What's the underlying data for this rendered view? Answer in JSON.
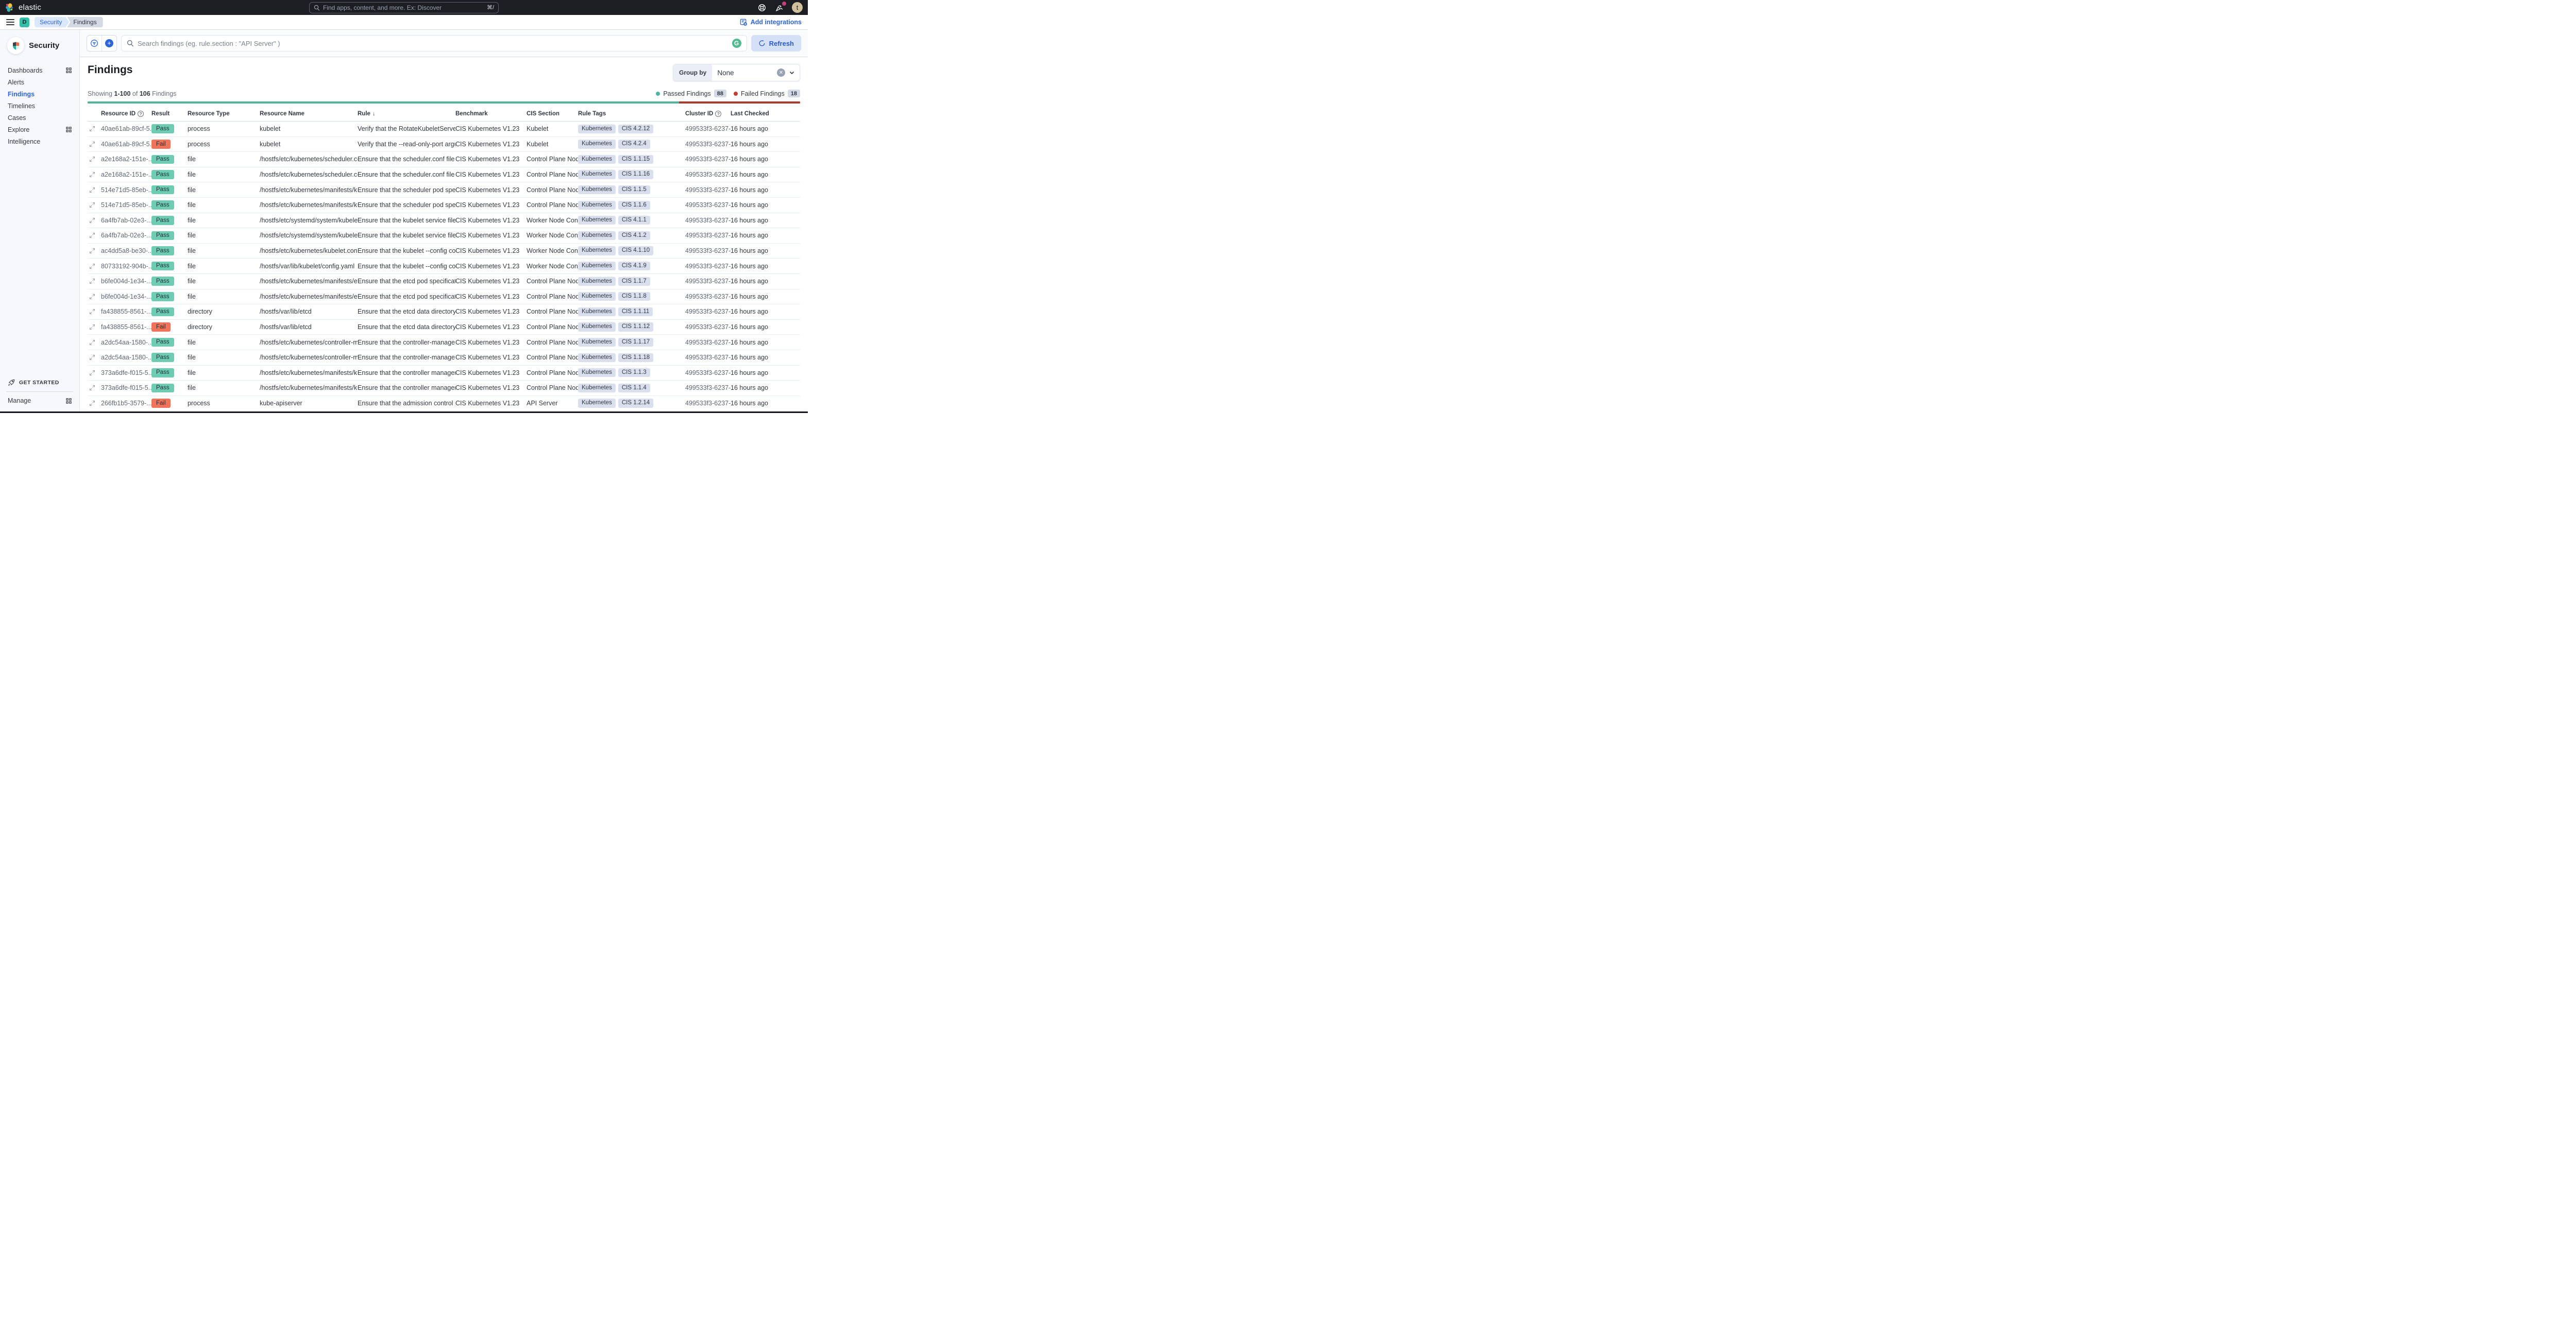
{
  "header": {
    "logo_text": "elastic",
    "search_placeholder": "Find apps, content, and more. Ex: Discover",
    "search_shortcut": "⌘/",
    "avatar_initial": "t"
  },
  "breadcrumb_bar": {
    "deployment_initial": "D",
    "crumbs": {
      "first": "Security",
      "last": "Findings"
    },
    "add_integrations_label": "Add integrations"
  },
  "sidebar": {
    "title": "Security",
    "items": [
      {
        "label": "Dashboards",
        "grid_icon": true
      },
      {
        "label": "Alerts",
        "grid_icon": false
      },
      {
        "label": "Findings",
        "grid_icon": false,
        "active": true
      },
      {
        "label": "Timelines",
        "grid_icon": false
      },
      {
        "label": "Cases",
        "grid_icon": false
      },
      {
        "label": "Explore",
        "grid_icon": true
      },
      {
        "label": "Intelligence",
        "grid_icon": false
      }
    ],
    "get_started_label": "GET STARTED",
    "manage_label": "Manage"
  },
  "toolbar": {
    "search_placeholder": "Search findings (eg. rule.section : \"API Server\" )",
    "refresh_label": "Refresh"
  },
  "page": {
    "title": "Findings",
    "group_by_label": "Group by",
    "group_by_value": "None"
  },
  "summary": {
    "showing_word": "Showing",
    "range": "1-100",
    "of_word": "of",
    "total": "106",
    "suffix_word": "Findings",
    "passed_label": "Passed Findings",
    "passed_count": "88",
    "failed_label": "Failed Findings",
    "failed_count": "18"
  },
  "colors": {
    "pass_badge": "#6dccb1",
    "fail_badge": "#f0735c",
    "passed_bar": "#54b399",
    "failed_bar": "#aa392e",
    "accent_blue": "#2d64d8",
    "deployment_teal": "#36bdaa"
  },
  "table": {
    "columns": [
      {
        "label": "Resource ID",
        "help": true
      },
      {
        "label": "Result"
      },
      {
        "label": "Resource Type"
      },
      {
        "label": "Resource Name"
      },
      {
        "label": "Rule",
        "sorted": "desc"
      },
      {
        "label": "Benchmark"
      },
      {
        "label": "CIS Section"
      },
      {
        "label": "Rule Tags"
      },
      {
        "label": "Cluster ID",
        "help": true
      },
      {
        "label": "Last Checked"
      }
    ],
    "rows": [
      {
        "resource_id": "40ae61ab-89cf-5...",
        "result": "Pass",
        "resource_type": "process",
        "resource_name": "kubelet",
        "rule": "Verify that the RotateKubeletServerCertifi...",
        "benchmark": "CIS Kubernetes V1.23",
        "cis_section": "Kubelet",
        "rule_tags": [
          "Kubernetes",
          "CIS 4.2.12"
        ],
        "cluster_id": "499533f3-6237-...",
        "last_checked": "16 hours ago"
      },
      {
        "resource_id": "40ae61ab-89cf-5...",
        "result": "Fail",
        "resource_type": "process",
        "resource_name": "kubelet",
        "rule": "Verify that the --read-only-port argument ...",
        "benchmark": "CIS Kubernetes V1.23",
        "cis_section": "Kubelet",
        "rule_tags": [
          "Kubernetes",
          "CIS 4.2.4"
        ],
        "cluster_id": "499533f3-6237-...",
        "last_checked": "16 hours ago"
      },
      {
        "resource_id": "a2e168a2-151e-...",
        "result": "Pass",
        "resource_type": "file",
        "resource_name": "/hostfs/etc/kubernetes/scheduler.conf",
        "rule": "Ensure that the scheduler.conf file permis...",
        "benchmark": "CIS Kubernetes V1.23",
        "cis_section": "Control Plane Node...",
        "rule_tags": [
          "Kubernetes",
          "CIS 1.1.15"
        ],
        "cluster_id": "499533f3-6237-...",
        "last_checked": "16 hours ago"
      },
      {
        "resource_id": "a2e168a2-151e-...",
        "result": "Pass",
        "resource_type": "file",
        "resource_name": "/hostfs/etc/kubernetes/scheduler.conf",
        "rule": "Ensure that the scheduler.conf file owners...",
        "benchmark": "CIS Kubernetes V1.23",
        "cis_section": "Control Plane Node...",
        "rule_tags": [
          "Kubernetes",
          "CIS 1.1.16"
        ],
        "cluster_id": "499533f3-6237-...",
        "last_checked": "16 hours ago"
      },
      {
        "resource_id": "514e71d5-85eb-...",
        "result": "Pass",
        "resource_type": "file",
        "resource_name": "/hostfs/etc/kubernetes/manifests/kube-sc...",
        "rule": "Ensure that the scheduler pod specificatio...",
        "benchmark": "CIS Kubernetes V1.23",
        "cis_section": "Control Plane Node...",
        "rule_tags": [
          "Kubernetes",
          "CIS 1.1.5"
        ],
        "cluster_id": "499533f3-6237-...",
        "last_checked": "16 hours ago"
      },
      {
        "resource_id": "514e71d5-85eb-...",
        "result": "Pass",
        "resource_type": "file",
        "resource_name": "/hostfs/etc/kubernetes/manifests/kube-sc...",
        "rule": "Ensure that the scheduler pod specificatio...",
        "benchmark": "CIS Kubernetes V1.23",
        "cis_section": "Control Plane Node...",
        "rule_tags": [
          "Kubernetes",
          "CIS 1.1.6"
        ],
        "cluster_id": "499533f3-6237-...",
        "last_checked": "16 hours ago"
      },
      {
        "resource_id": "6a4fb7ab-02e3-...",
        "result": "Pass",
        "resource_type": "file",
        "resource_name": "/hostfs/etc/systemd/system/kubelet.servi...",
        "rule": "Ensure that the kubelet service file permis...",
        "benchmark": "CIS Kubernetes V1.23",
        "cis_section": "Worker Node Confi...",
        "rule_tags": [
          "Kubernetes",
          "CIS 4.1.1"
        ],
        "cluster_id": "499533f3-6237-...",
        "last_checked": "16 hours ago"
      },
      {
        "resource_id": "6a4fb7ab-02e3-...",
        "result": "Pass",
        "resource_type": "file",
        "resource_name": "/hostfs/etc/systemd/system/kubelet.servi...",
        "rule": "Ensure that the kubelet service file owner...",
        "benchmark": "CIS Kubernetes V1.23",
        "cis_section": "Worker Node Confi...",
        "rule_tags": [
          "Kubernetes",
          "CIS 4.1.2"
        ],
        "cluster_id": "499533f3-6237-...",
        "last_checked": "16 hours ago"
      },
      {
        "resource_id": "ac4dd5a8-be30-...",
        "result": "Pass",
        "resource_type": "file",
        "resource_name": "/hostfs/etc/kubernetes/kubelet.conf",
        "rule": "Ensure that the kubelet --config configura...",
        "benchmark": "CIS Kubernetes V1.23",
        "cis_section": "Worker Node Confi...",
        "rule_tags": [
          "Kubernetes",
          "CIS 4.1.10"
        ],
        "cluster_id": "499533f3-6237-...",
        "last_checked": "16 hours ago"
      },
      {
        "resource_id": "80733192-904b-...",
        "result": "Pass",
        "resource_type": "file",
        "resource_name": "/hostfs/var/lib/kubelet/config.yaml",
        "rule": "Ensure that the kubelet --config configura...",
        "benchmark": "CIS Kubernetes V1.23",
        "cis_section": "Worker Node Confi...",
        "rule_tags": [
          "Kubernetes",
          "CIS 4.1.9"
        ],
        "cluster_id": "499533f3-6237-...",
        "last_checked": "16 hours ago"
      },
      {
        "resource_id": "b6fe004d-1e34-...",
        "result": "Pass",
        "resource_type": "file",
        "resource_name": "/hostfs/etc/kubernetes/manifests/etcd.yaml",
        "rule": "Ensure that the etcd pod specification file ...",
        "benchmark": "CIS Kubernetes V1.23",
        "cis_section": "Control Plane Node...",
        "rule_tags": [
          "Kubernetes",
          "CIS 1.1.7"
        ],
        "cluster_id": "499533f3-6237-...",
        "last_checked": "16 hours ago"
      },
      {
        "resource_id": "b6fe004d-1e34-...",
        "result": "Pass",
        "resource_type": "file",
        "resource_name": "/hostfs/etc/kubernetes/manifests/etcd.yaml",
        "rule": "Ensure that the etcd pod specification file ...",
        "benchmark": "CIS Kubernetes V1.23",
        "cis_section": "Control Plane Node...",
        "rule_tags": [
          "Kubernetes",
          "CIS 1.1.8"
        ],
        "cluster_id": "499533f3-6237-...",
        "last_checked": "16 hours ago"
      },
      {
        "resource_id": "fa438855-8561-...",
        "result": "Pass",
        "resource_type": "directory",
        "resource_name": "/hostfs/var/lib/etcd",
        "rule": "Ensure that the etcd data directory permis...",
        "benchmark": "CIS Kubernetes V1.23",
        "cis_section": "Control Plane Node...",
        "rule_tags": [
          "Kubernetes",
          "CIS 1.1.11"
        ],
        "cluster_id": "499533f3-6237-...",
        "last_checked": "16 hours ago"
      },
      {
        "resource_id": "fa438855-8561-...",
        "result": "Fail",
        "resource_type": "directory",
        "resource_name": "/hostfs/var/lib/etcd",
        "rule": "Ensure that the etcd data directory owner...",
        "benchmark": "CIS Kubernetes V1.23",
        "cis_section": "Control Plane Node...",
        "rule_tags": [
          "Kubernetes",
          "CIS 1.1.12"
        ],
        "cluster_id": "499533f3-6237-...",
        "last_checked": "16 hours ago"
      },
      {
        "resource_id": "a2dc54aa-1580-...",
        "result": "Pass",
        "resource_type": "file",
        "resource_name": "/hostfs/etc/kubernetes/controller-manage...",
        "rule": "Ensure that the controller-manager.conf fil...",
        "benchmark": "CIS Kubernetes V1.23",
        "cis_section": "Control Plane Node...",
        "rule_tags": [
          "Kubernetes",
          "CIS 1.1.17"
        ],
        "cluster_id": "499533f3-6237-...",
        "last_checked": "16 hours ago"
      },
      {
        "resource_id": "a2dc54aa-1580-...",
        "result": "Pass",
        "resource_type": "file",
        "resource_name": "/hostfs/etc/kubernetes/controller-manage...",
        "rule": "Ensure that the controller-manager.conf fil...",
        "benchmark": "CIS Kubernetes V1.23",
        "cis_section": "Control Plane Node...",
        "rule_tags": [
          "Kubernetes",
          "CIS 1.1.18"
        ],
        "cluster_id": "499533f3-6237-...",
        "last_checked": "16 hours ago"
      },
      {
        "resource_id": "373a6dfe-f015-5...",
        "result": "Pass",
        "resource_type": "file",
        "resource_name": "/hostfs/etc/kubernetes/manifests/kube-co...",
        "rule": "Ensure that the controller manager pod sp...",
        "benchmark": "CIS Kubernetes V1.23",
        "cis_section": "Control Plane Node...",
        "rule_tags": [
          "Kubernetes",
          "CIS 1.1.3"
        ],
        "cluster_id": "499533f3-6237-...",
        "last_checked": "16 hours ago"
      },
      {
        "resource_id": "373a6dfe-f015-5...",
        "result": "Pass",
        "resource_type": "file",
        "resource_name": "/hostfs/etc/kubernetes/manifests/kube-co...",
        "rule": "Ensure that the controller manager pod sp...",
        "benchmark": "CIS Kubernetes V1.23",
        "cis_section": "Control Plane Node...",
        "rule_tags": [
          "Kubernetes",
          "CIS 1.1.4"
        ],
        "cluster_id": "499533f3-6237-...",
        "last_checked": "16 hours ago"
      },
      {
        "resource_id": "266fb1b5-3579-...",
        "result": "Fail",
        "resource_type": "process",
        "resource_name": "kube-apiserver",
        "rule": "Ensure that the admission control plugin S...",
        "benchmark": "CIS Kubernetes V1.23",
        "cis_section": "API Server",
        "rule_tags": [
          "Kubernetes",
          "CIS 1.2.14"
        ],
        "cluster_id": "499533f3-6237-...",
        "last_checked": "16 hours ago"
      }
    ]
  }
}
